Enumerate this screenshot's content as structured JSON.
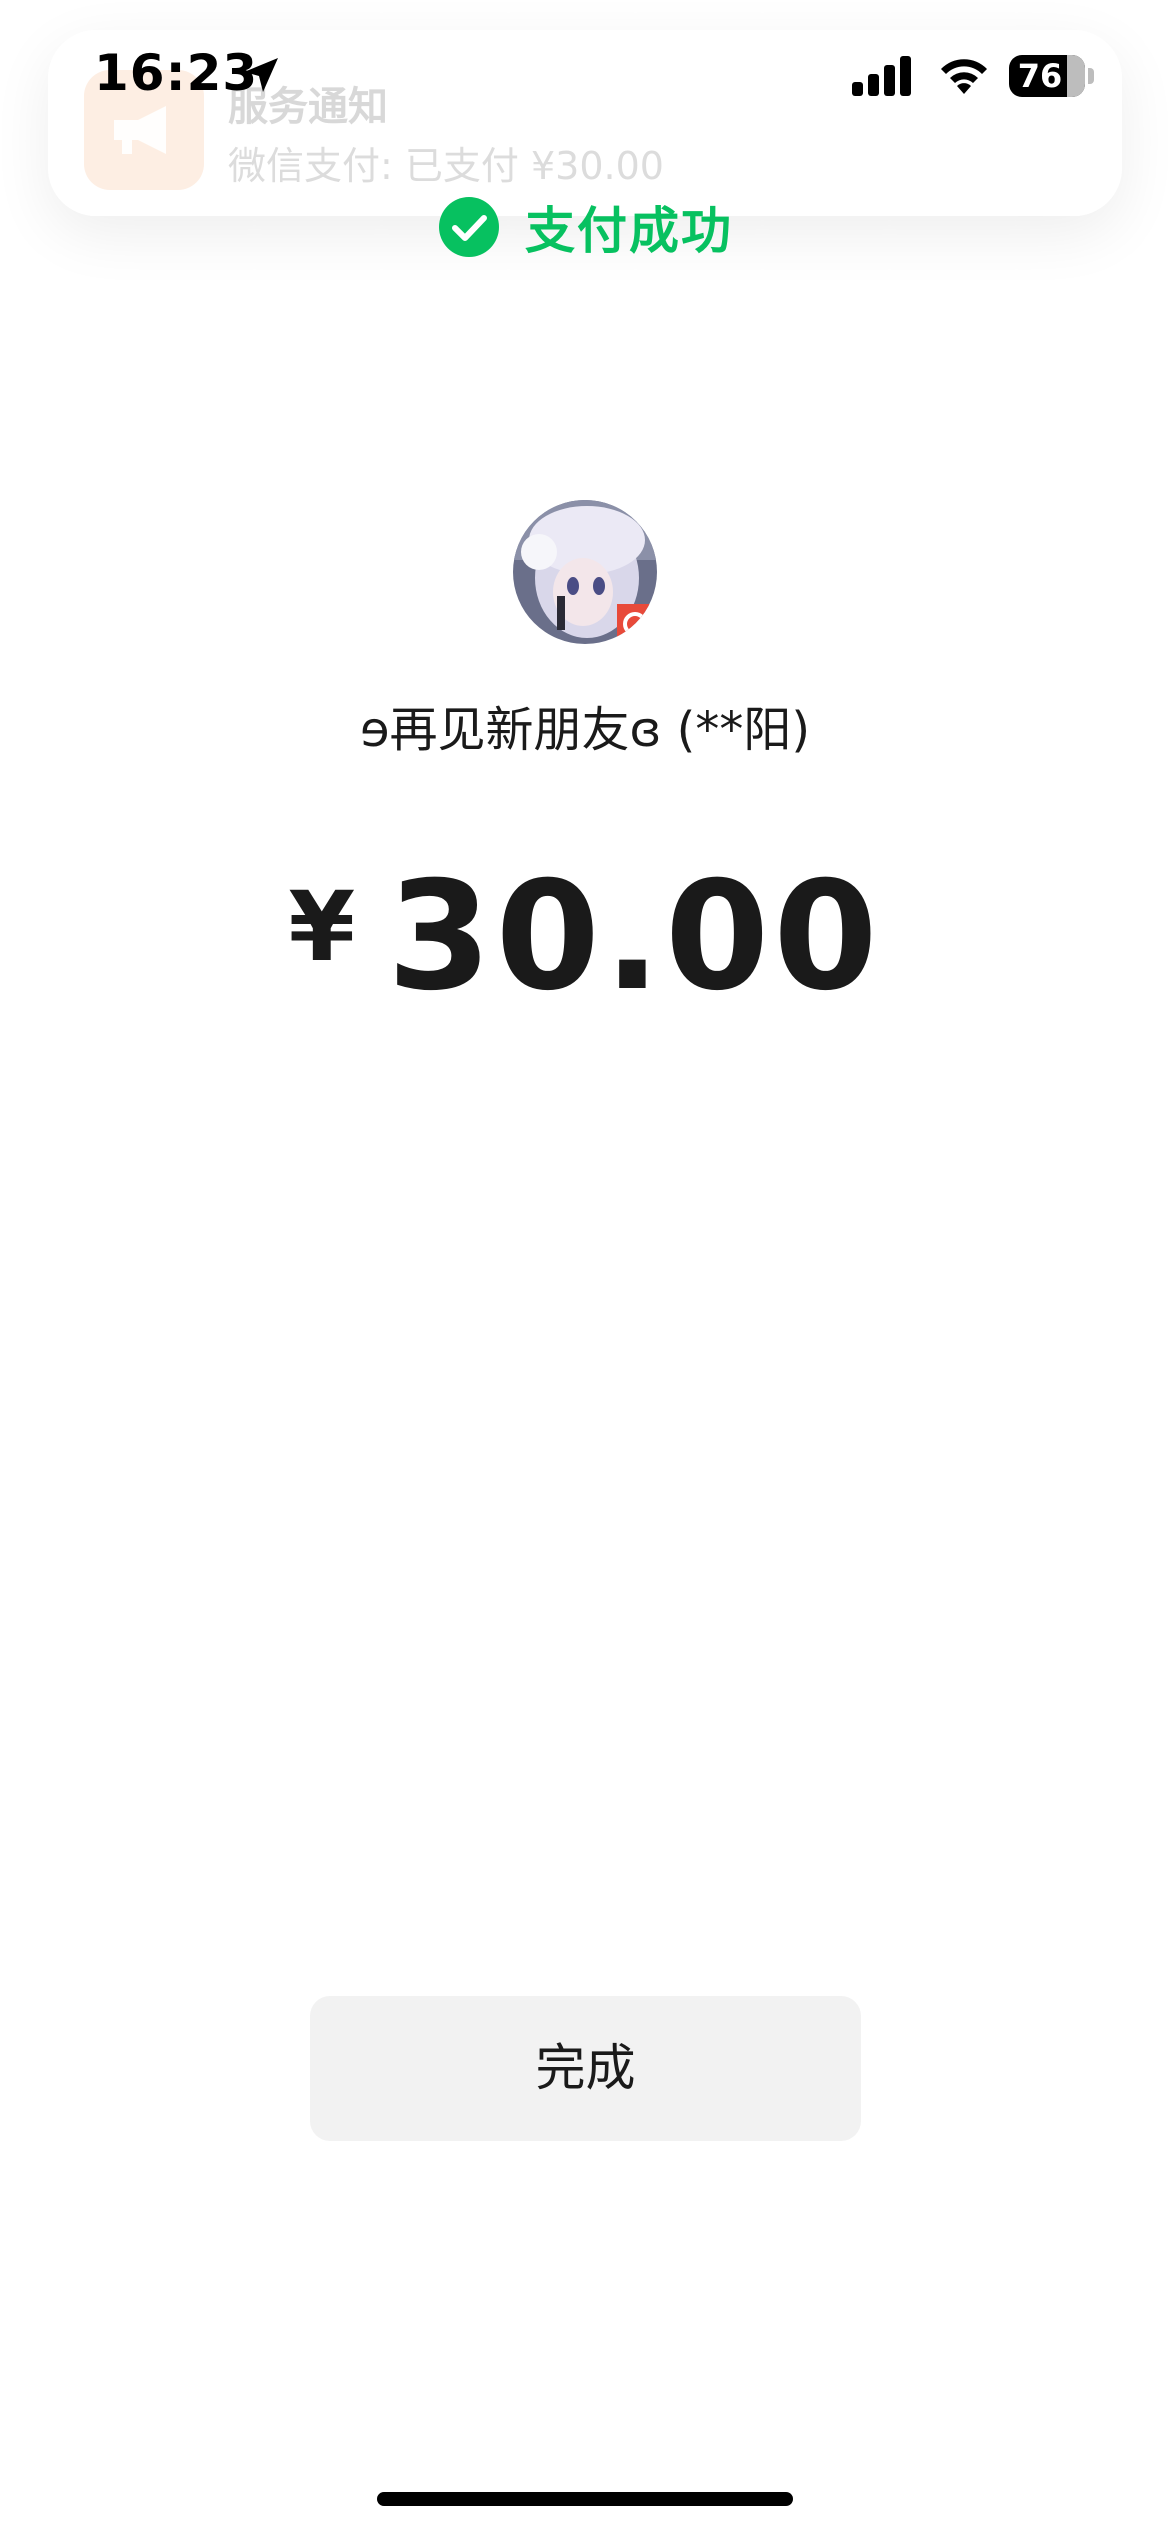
{
  "status_bar": {
    "time": "16:23",
    "battery_level": "76",
    "icons": [
      "location-arrow-icon",
      "cellular-signal-icon",
      "wifi-icon",
      "battery-icon"
    ]
  },
  "notification": {
    "app_icon": "megaphone-icon",
    "title": "服务通知",
    "body": "微信支付: 已支付 ¥30.00"
  },
  "payment": {
    "status_icon": "check-circle-icon",
    "status_text": "支付成功",
    "status_color": "#07c160",
    "payee": "ɘ再见新朋友ɞ (**阳)",
    "currency_symbol": "¥",
    "amount": "30.00"
  },
  "actions": {
    "done_label": "完成"
  }
}
